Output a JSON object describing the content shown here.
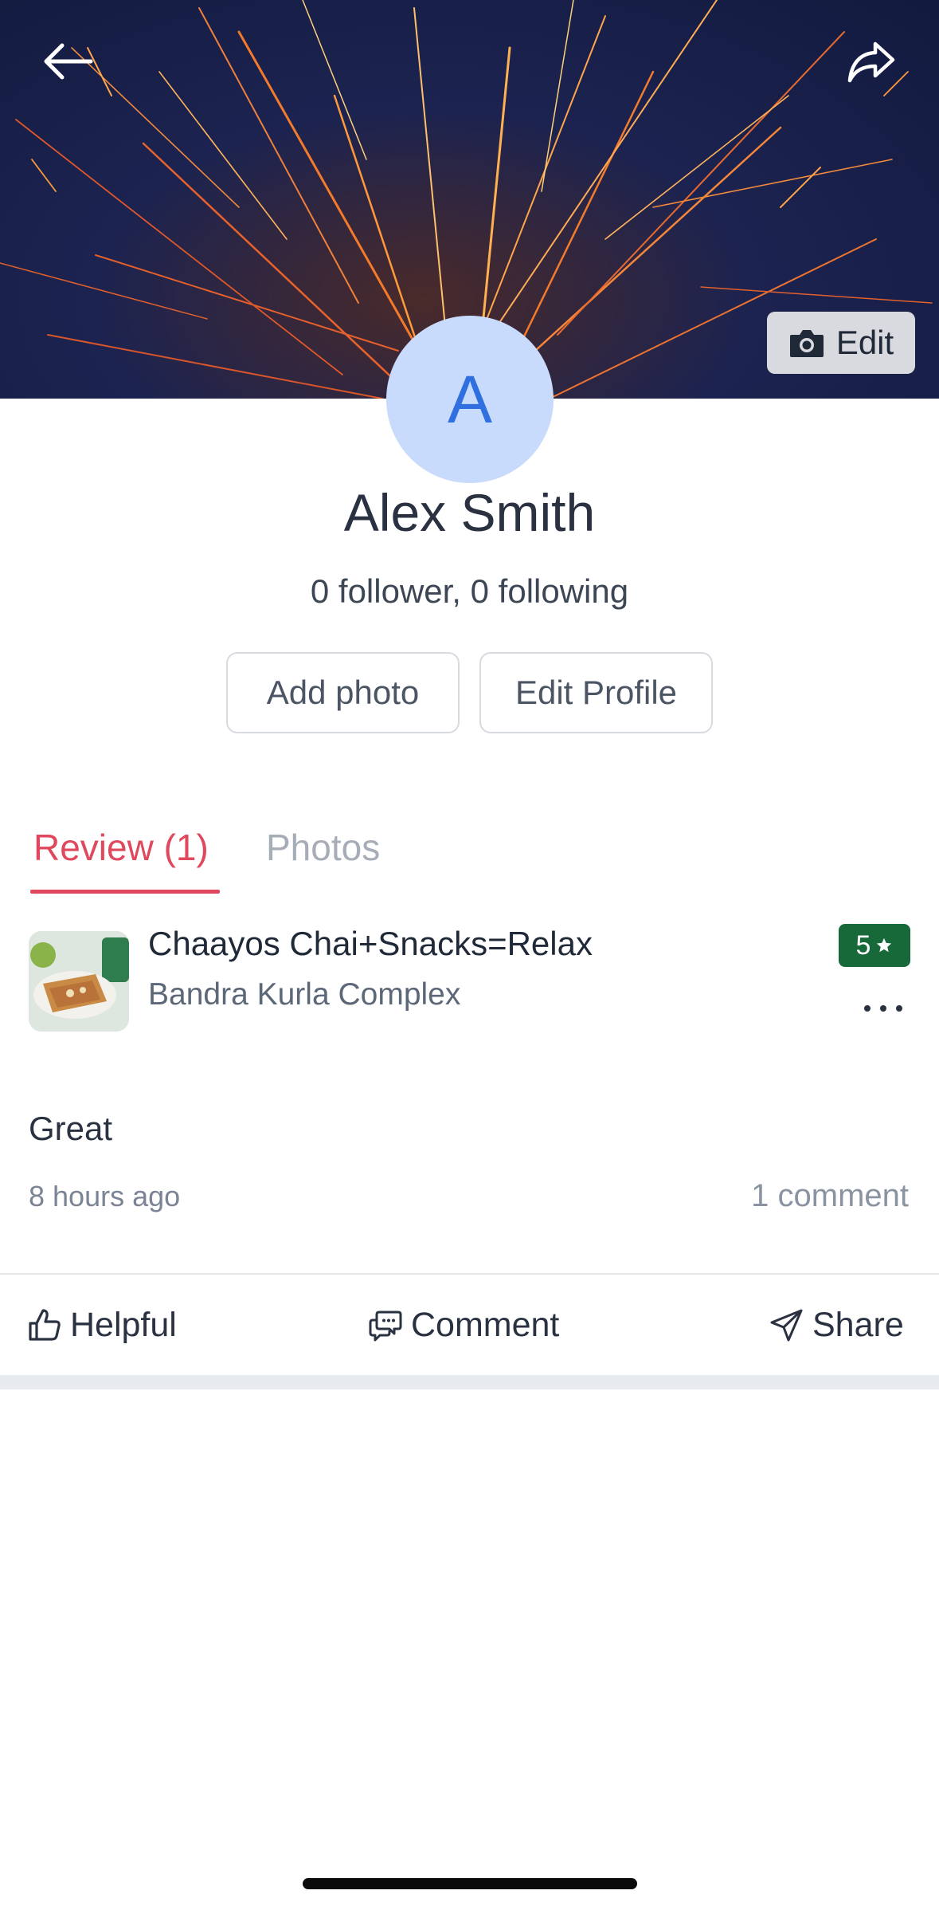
{
  "header": {
    "back_icon": "arrow-left-icon",
    "share_icon": "share-forward-icon",
    "edit_cover_label": "Edit",
    "edit_cover_icon": "camera-icon"
  },
  "profile": {
    "avatar_initial": "A",
    "name": "Alex Smith",
    "follow_stats": "0 follower, 0 following",
    "add_photo_label": "Add photo",
    "edit_profile_label": "Edit Profile"
  },
  "tabs": [
    {
      "label": "Review (1)",
      "active": true
    },
    {
      "label": "Photos",
      "active": false
    }
  ],
  "review": {
    "restaurant_name": "Chaayos Chai+Snacks=Relax",
    "restaurant_location": "Bandra Kurla Complex",
    "rating": "5",
    "rating_icon": "star-icon",
    "text": "Great",
    "time_ago": "8 hours ago",
    "comment_count": "1 comment",
    "actions": {
      "helpful": "Helpful",
      "comment": "Comment",
      "share": "Share"
    }
  },
  "colors": {
    "accent": "#e0495d",
    "rating_bg": "#17693a",
    "avatar_bg": "#c8dbfc",
    "avatar_text": "#2f6fe0"
  }
}
